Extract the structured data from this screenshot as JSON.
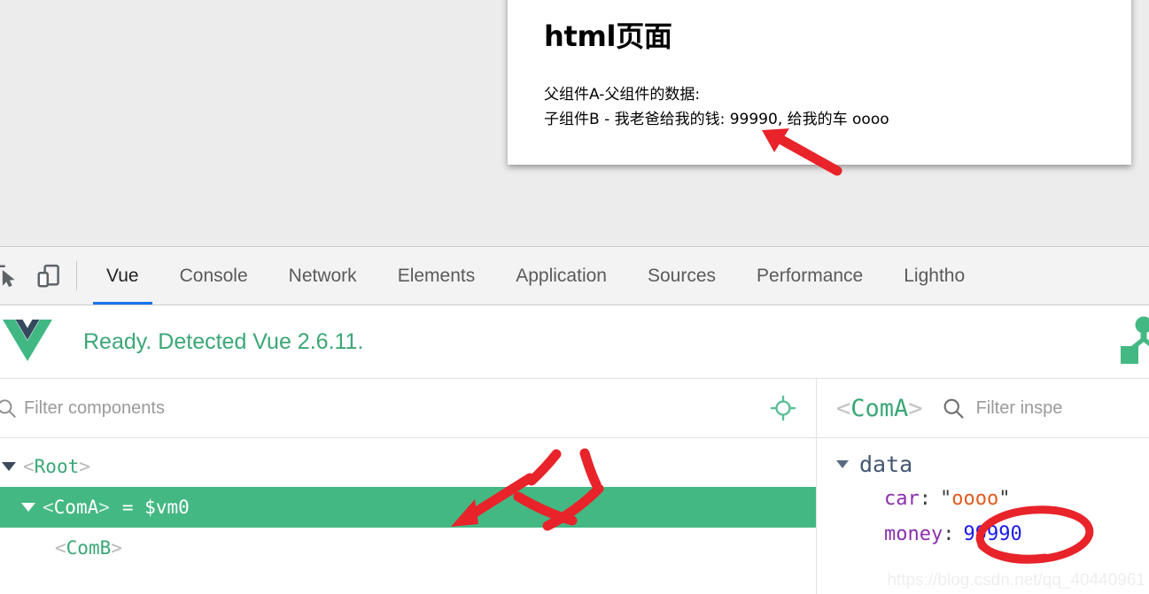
{
  "browser_page": {
    "title": "html页面",
    "lines": [
      "父组件A-父组件的数据:",
      "子组件B - 我老爸给我的钱: 99990, 给我的车 oooo"
    ]
  },
  "devtools": {
    "tools": [
      {
        "name": "inspect-element-icon",
        "label": "Inspect element"
      },
      {
        "name": "device-toolbar-icon",
        "label": "Toggle device toolbar"
      }
    ],
    "tabs": [
      {
        "label": "Vue",
        "active": true
      },
      {
        "label": "Console",
        "active": false
      },
      {
        "label": "Network",
        "active": false
      },
      {
        "label": "Elements",
        "active": false
      },
      {
        "label": "Application",
        "active": false
      },
      {
        "label": "Sources",
        "active": false
      },
      {
        "label": "Performance",
        "active": false
      },
      {
        "label": "Lightho",
        "active": false
      }
    ],
    "active_tab_underline_color": "#1a73e8"
  },
  "vue_devtools": {
    "logo_name": "vue-logo",
    "status_text": "Ready. Detected Vue 2.6.11.",
    "status_color": "#3ba776",
    "header_right_icon": "component-relations-icon",
    "components_panel": {
      "filter_placeholder": "Filter components",
      "filter_value": "",
      "target_icon": "select-component-target-icon",
      "tree": [
        {
          "name": "Root",
          "indent": 0,
          "has_caret": true,
          "selected": false,
          "suffix": ""
        },
        {
          "name": "ComA",
          "indent": 1,
          "has_caret": true,
          "selected": true,
          "suffix": "= $vm0"
        },
        {
          "name": "ComB",
          "indent": 2,
          "has_caret": false,
          "selected": false,
          "suffix": ""
        }
      ],
      "selected_row_color": "#44b883"
    },
    "inspector_panel": {
      "component_open_angle": "<",
      "component_name": "ComA",
      "component_close_angle": ">",
      "filter_placeholder": "Filter inspe",
      "filter_value": "",
      "groups": [
        {
          "label": "data",
          "expanded": true,
          "props": [
            {
              "key": "car",
              "value": "oooo",
              "type": "string"
            },
            {
              "key": "money",
              "value": "99990",
              "type": "number"
            }
          ]
        }
      ]
    }
  },
  "annotations": {
    "color": "#e8232a",
    "arrow_to_money_label": "arrow pointing to 99990 in page output",
    "parent_mark_text": "父",
    "arrow_to_coma_label": "arrow pointing to ComA row",
    "circle_around_money_label": "circle around money value 99990"
  },
  "watermark": {
    "text": "https://blog.csdn.net/qq_40440961"
  }
}
